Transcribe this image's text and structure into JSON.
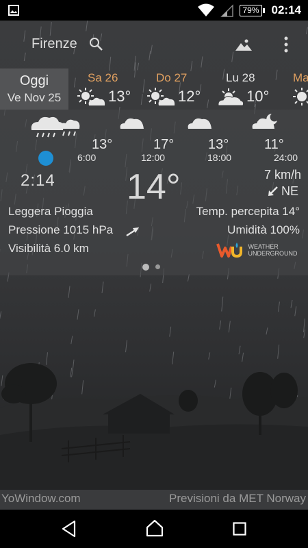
{
  "status_bar": {
    "battery": "79%",
    "time": "02:14",
    "icons": [
      "image-notification-icon",
      "wifi-icon",
      "cellular-signal-icon",
      "battery-icon"
    ]
  },
  "header": {
    "city": "Firenze",
    "icons": [
      "search-icon",
      "landscape-icon",
      "overflow-menu-icon"
    ]
  },
  "days": [
    {
      "label": "Oggi",
      "date": "Ve Nov 25",
      "selected": true
    },
    {
      "label": "Sa 26",
      "temp": "13°",
      "icon": "partly-sunny-icon"
    },
    {
      "label": "Do 27",
      "temp": "12°",
      "icon": "partly-sunny-icon"
    },
    {
      "label": "Lu 28",
      "temp": "10°",
      "icon": "partly-cloudy-icon"
    },
    {
      "label": "Ma",
      "icon": "sunny-icon"
    }
  ],
  "hourly": [
    {
      "icon": "rain-cloud-icon"
    },
    {
      "temp": "13°",
      "time": "6:00",
      "icon": "cloud-icon"
    },
    {
      "temp": "17°",
      "time": "12:00",
      "icon": "cloud-icon"
    },
    {
      "temp": "13°",
      "time": "18:00",
      "icon": "cloud-icon"
    },
    {
      "temp": "11°",
      "time": "24:00",
      "icon": "cloud-moon-icon"
    }
  ],
  "current": {
    "time": "2:14",
    "temperature": "14°",
    "wind_speed": "7 km/h",
    "wind_direction": "NE",
    "condition": "Leggera Pioggia",
    "pressure": "Pressione 1015 hPa",
    "visibility": "Visibilità 6.0 km",
    "feels_like": "Temp. percepita 14°",
    "humidity": "Umidità 100%",
    "provider_logo_text_1": "WEATHER",
    "provider_logo_text_2": "UNDERGROUND"
  },
  "pager": {
    "pages": 2,
    "current": 1
  },
  "footer": {
    "left": "YoWindow.com",
    "right": "Previsioni da MET Norway"
  },
  "colors": {
    "accent_day": "#e0a060",
    "now_dot": "#1e8fd4",
    "background": "#3a3b3d"
  }
}
